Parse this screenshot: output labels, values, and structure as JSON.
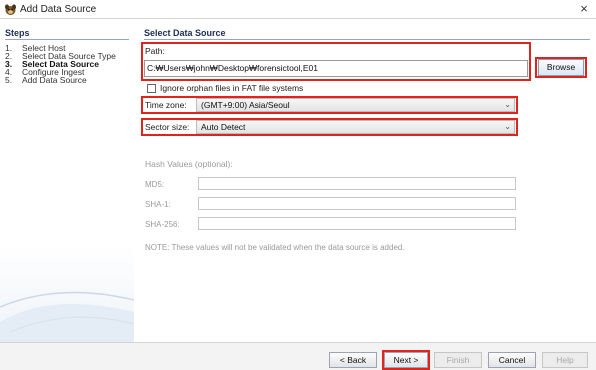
{
  "window": {
    "title": "Add Data Source",
    "close_glyph": "×",
    "app_icon": "autopsy-dog-icon"
  },
  "steps": {
    "title": "Steps",
    "items": [
      {
        "num": "1.",
        "label": "Select Host",
        "current": false
      },
      {
        "num": "2.",
        "label": "Select Data Source Type",
        "current": false
      },
      {
        "num": "3.",
        "label": "Select Data Source",
        "current": true
      },
      {
        "num": "4.",
        "label": "Configure Ingest",
        "current": false
      },
      {
        "num": "5.",
        "label": "Add Data Source",
        "current": false
      }
    ]
  },
  "main": {
    "section_title": "Select Data Source",
    "path": {
      "label": "Path:",
      "value": "C:₩Users₩john₩Desktop₩forensictool,E01",
      "browse_label": "Browse"
    },
    "ignore_orphan": {
      "label": "Ignore orphan files in FAT file systems",
      "checked": false
    },
    "time_zone": {
      "label": "Time zone:",
      "value": "(GMT+9:00) Asia/Seoul"
    },
    "sector_size": {
      "label": "Sector size:",
      "value": "Auto Detect"
    },
    "hash": {
      "title": "Hash Values (optional):",
      "md5_label": "MD5:",
      "sha1_label": "SHA-1:",
      "sha256_label": "SHA-256:",
      "note": "NOTE: These values will not be validated when the data source is added."
    }
  },
  "footer": {
    "back_label": "< Back",
    "next_label": "Next >",
    "finish_label": "Finish",
    "cancel_label": "Cancel",
    "help_label": "Help"
  },
  "colors": {
    "highlight": "#e0241b",
    "heading": "#1e2d55"
  }
}
